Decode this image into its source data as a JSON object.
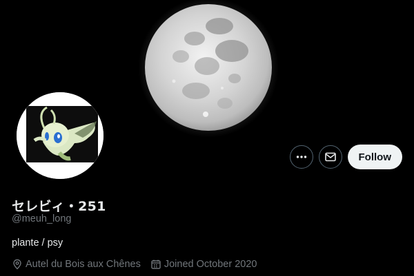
{
  "profile": {
    "display_name": "セレビィ・251",
    "handle": "@meuh_long",
    "bio": "plante / psy",
    "location": "Autel du Bois aux Chênes",
    "joined": "Joined October 2020"
  },
  "banner": {
    "image": "full-moon"
  },
  "avatar": {
    "image": "celebi"
  },
  "actions": {
    "more_icon": "more-horizontal-icon",
    "message_icon": "envelope-icon",
    "follow_label": "Follow"
  },
  "colors": {
    "background": "#000000",
    "primary_text": "#e7e9ea",
    "secondary_text": "#71767b",
    "button_border": "#536471",
    "follow_bg": "#eff3f4"
  }
}
